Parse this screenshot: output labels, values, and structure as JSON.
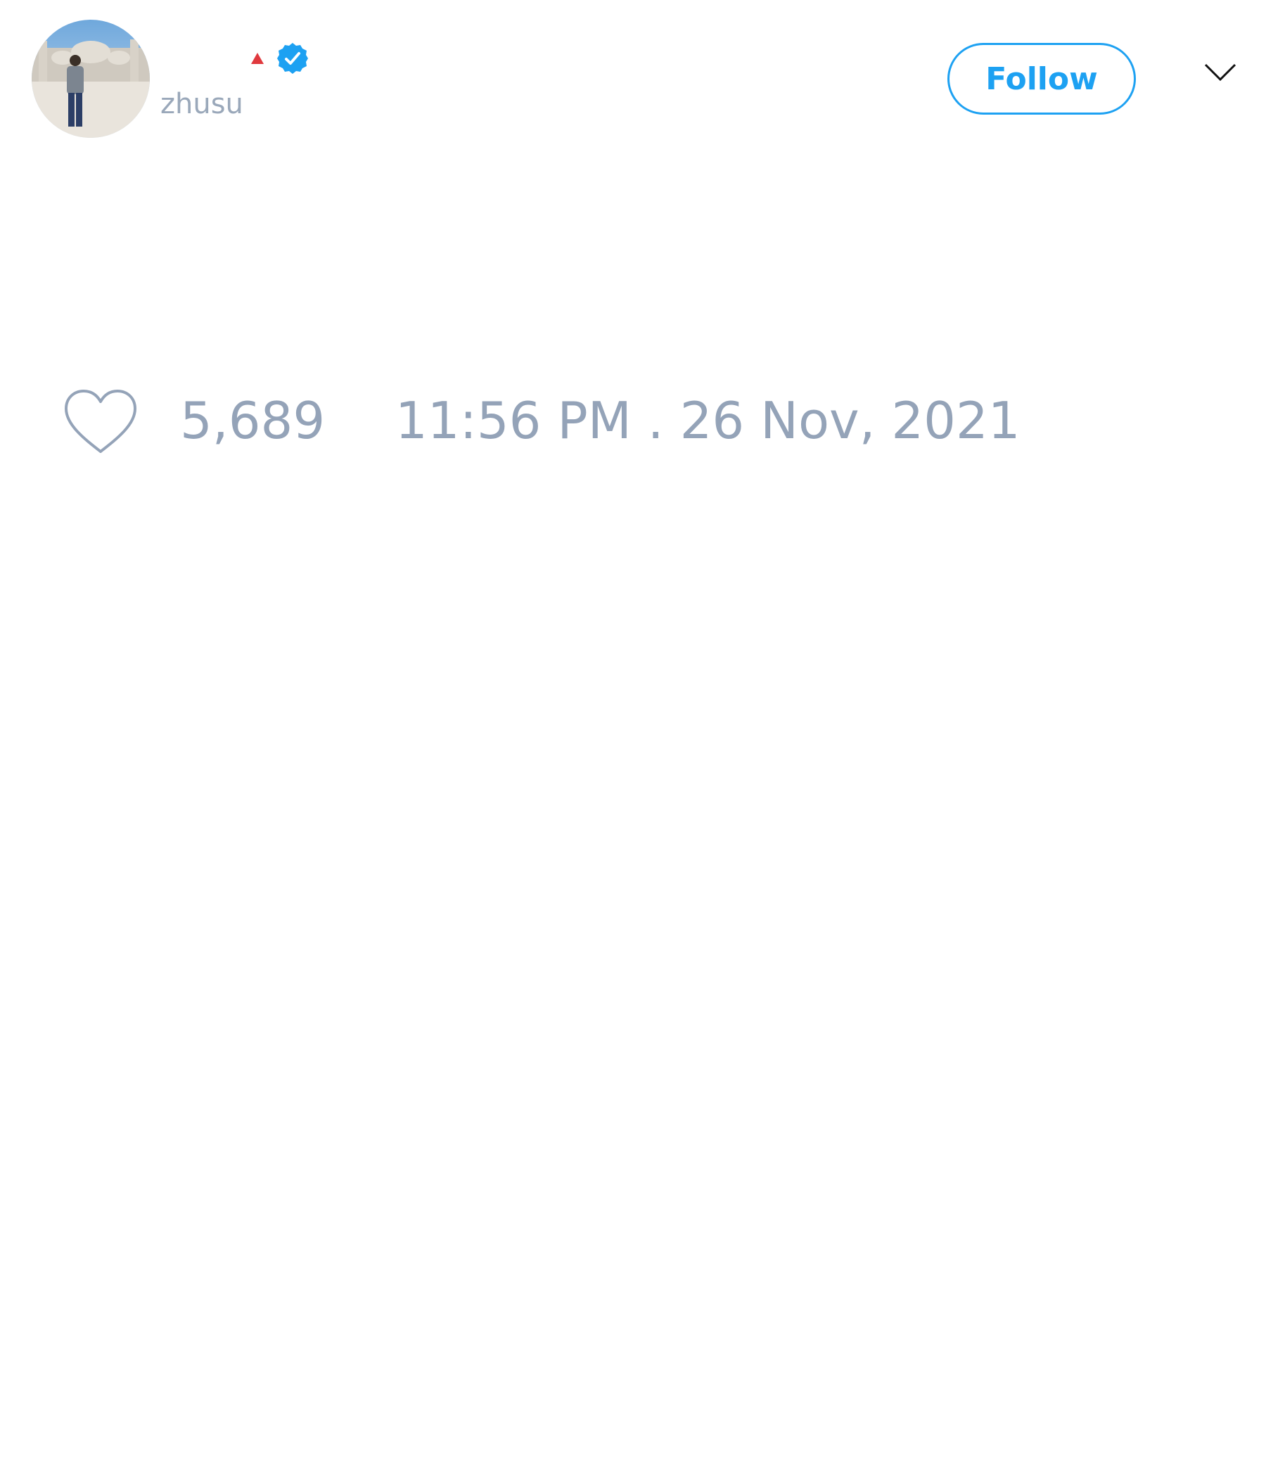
{
  "tweet": {
    "author": {
      "avatar": "profile-photo",
      "verified_icon": "verified-badge-icon",
      "handle": "zhusu"
    },
    "follow_label": "Follow",
    "menu_icon": "chevron-down-icon",
    "like_icon": "heart-icon",
    "likes": "5,689",
    "timestamp": "11:56 PM . 26 Nov, 2021"
  },
  "colors": {
    "accent": "#1da1f2",
    "muted_text": "#94a3b8",
    "flag": "#e0393e"
  }
}
